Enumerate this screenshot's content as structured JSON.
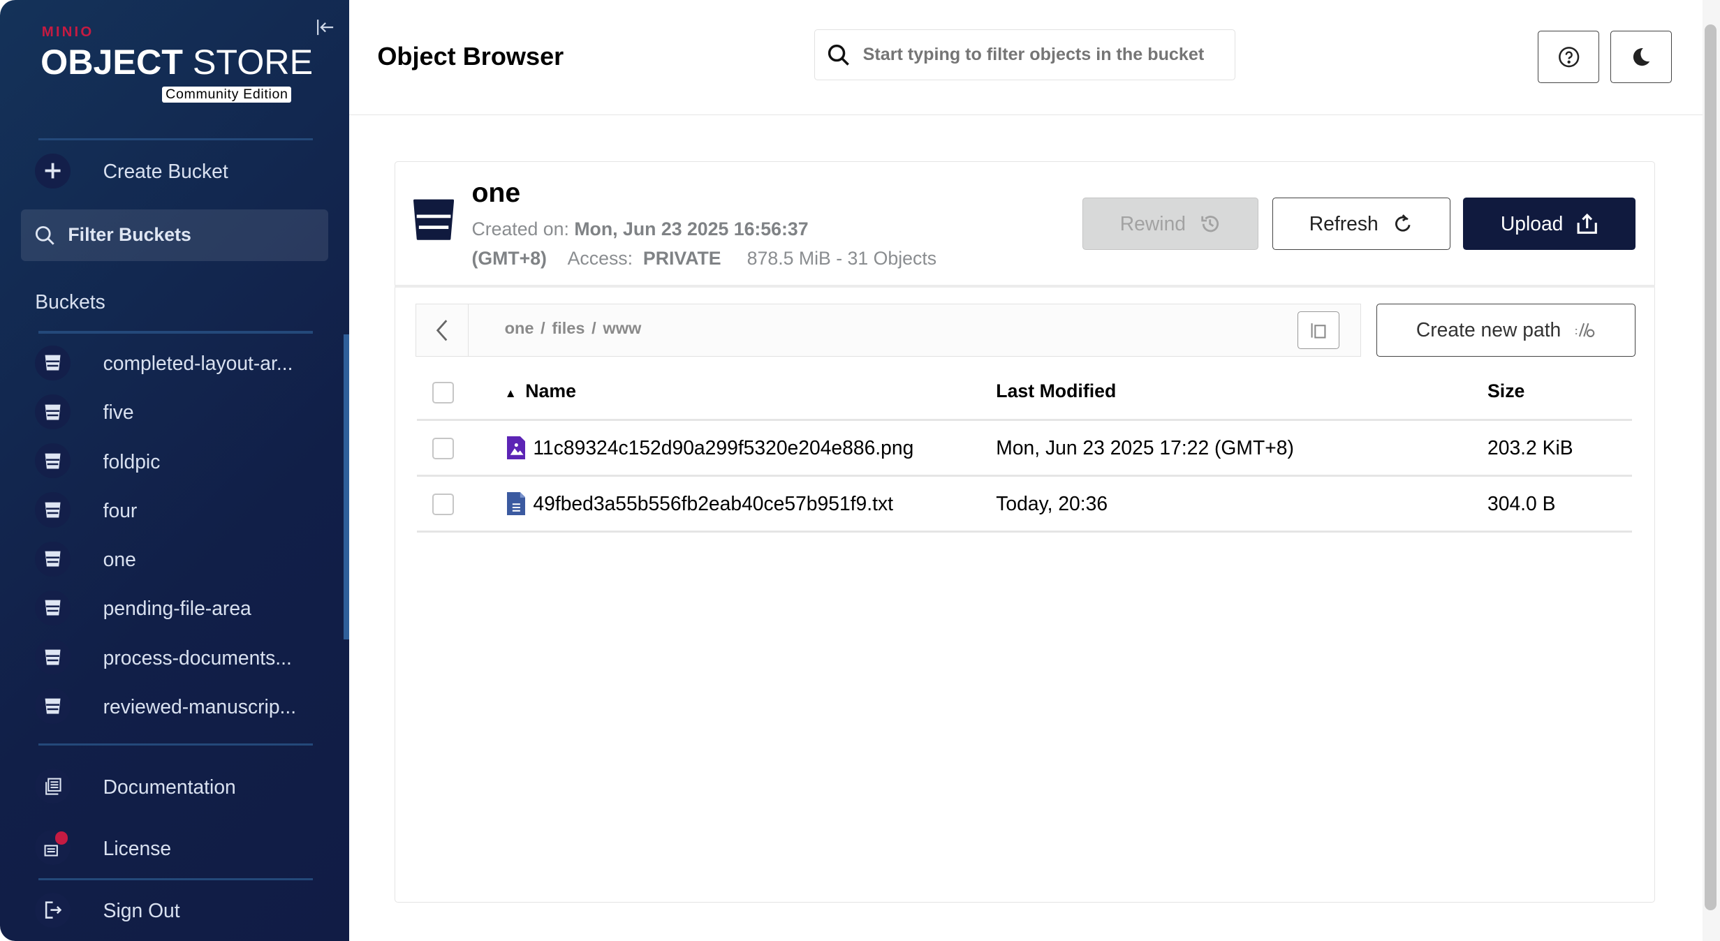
{
  "sidebar": {
    "brand": {
      "minio": "MINIO",
      "object": "OBJECT",
      "store": "STORE",
      "edition": "Community Edition"
    },
    "create_bucket": "Create Bucket",
    "filter_buckets": "Filter Buckets",
    "buckets_heading": "Buckets",
    "buckets": [
      "completed-layout-ar...",
      "five",
      "foldpic",
      "four",
      "one",
      "pending-file-area",
      "process-documents...",
      "reviewed-manuscrip..."
    ],
    "documentation": "Documentation",
    "license": "License",
    "sign_out": "Sign Out"
  },
  "header": {
    "title": "Object Browser",
    "search_placeholder": "Start typing to filter objects in the bucket"
  },
  "bucket": {
    "name": "one",
    "created_label": "Created on:",
    "created_value": "Mon, Jun 23 2025 16:56:37",
    "timezone": "(GMT+8)",
    "access_label": "Access:",
    "access_value": "PRIVATE",
    "usage": "878.5 MiB - 31 Objects",
    "rewind": "Rewind",
    "refresh": "Refresh",
    "upload": "Upload"
  },
  "path": {
    "crumbs": [
      "one",
      "files",
      "www"
    ],
    "create_new_path": "Create new path"
  },
  "table": {
    "columns": [
      "Name",
      "Last Modified",
      "Size"
    ],
    "rows": [
      {
        "name": "11c89324c152d90a299f5320e204e886.png",
        "modified": "Mon, Jun 23 2025 17:22 (GMT+8)",
        "size": "203.2 KiB",
        "type": "image"
      },
      {
        "name": "49fbed3a55b556fb2eab40ce57b951f9.txt",
        "modified": "Today, 20:36",
        "size": "304.0 B",
        "type": "text"
      }
    ]
  },
  "colors": {
    "sidebar": "#12244f",
    "accent_red": "#c51b42",
    "upload_bg": "#101a3e",
    "image_icon": "#5c24b5",
    "text_icon": "#3b5aa0"
  }
}
